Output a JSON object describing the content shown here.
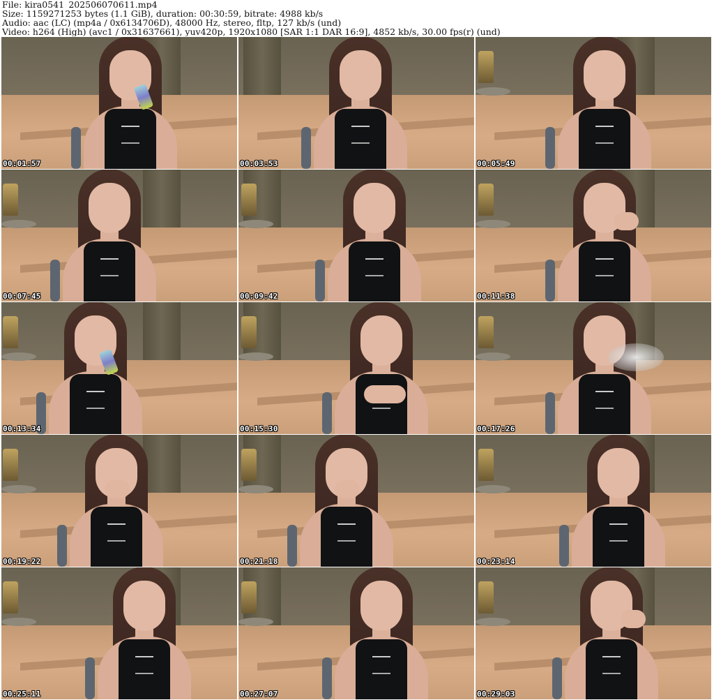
{
  "header": {
    "file_line": "File: kira0541_202506070611.mp4",
    "size_line": "Size: 1159271253 bytes (1.1 GiB), duration: 00:30:59, bitrate: 4988 kb/s",
    "audio_line": "Audio: aac (LC) (mp4a / 0x6134706D), 48000 Hz, stereo, fltp, 127 kb/s (und)",
    "video_line": "Video: h264 (High) (avc1 / 0x31637661), yuv420p, 1920x1080 [SAR 1:1 DAR 16:9], 4852 kb/s, 30.00 fps(r) (und)"
  },
  "thumbnails": [
    {
      "timestamp": "00:01:57",
      "variant": "drink"
    },
    {
      "timestamp": "00:03:53",
      "variant": "plain"
    },
    {
      "timestamp": "00:05:49",
      "variant": "plain"
    },
    {
      "timestamp": "00:07:45",
      "variant": "plain"
    },
    {
      "timestamp": "00:09:42",
      "variant": "plain"
    },
    {
      "timestamp": "00:11:38",
      "variant": "hand-cheek"
    },
    {
      "timestamp": "00:13:34",
      "variant": "drink"
    },
    {
      "timestamp": "00:15:30",
      "variant": "hand-chest"
    },
    {
      "timestamp": "00:17:26",
      "variant": "smoke"
    },
    {
      "timestamp": "00:19:22",
      "variant": "hand-mouth"
    },
    {
      "timestamp": "00:21:18",
      "variant": "hand-mouth"
    },
    {
      "timestamp": "00:23:14",
      "variant": "plain"
    },
    {
      "timestamp": "00:25:11",
      "variant": "plain"
    },
    {
      "timestamp": "00:27:07",
      "variant": "plain"
    },
    {
      "timestamp": "00:29:03",
      "variant": "hand-cheek"
    }
  ]
}
